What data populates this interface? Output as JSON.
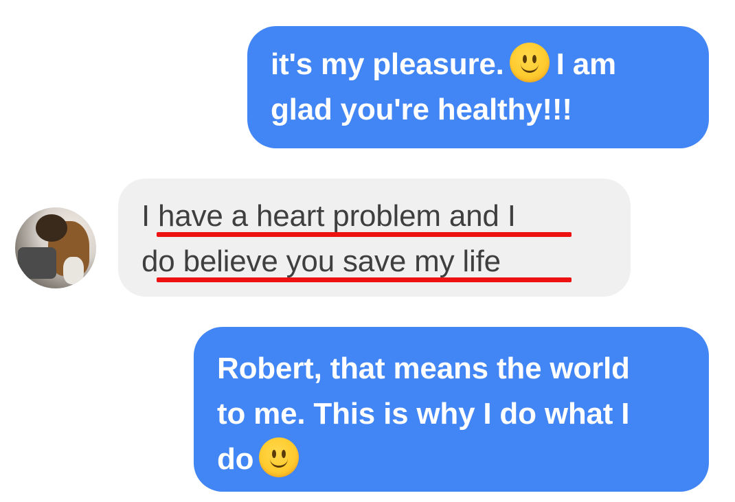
{
  "messages": [
    {
      "direction": "sent",
      "line1": "it's my pleasure.",
      "line1_after_emoji": "I am",
      "line2": "glad you're healthy!!!",
      "emoji": "slightly-smiling-face-icon"
    },
    {
      "direction": "received",
      "line1": "I have a heart problem and I",
      "line2": "do believe you save my life",
      "highlight": "red-underline"
    },
    {
      "direction": "sent",
      "line1": "Robert, that means the world",
      "line2": "to me. This is why I do what I",
      "line3": "do",
      "emoji": "slightly-smiling-face-icon"
    }
  ],
  "colors": {
    "sent_bubble": "#4285f4",
    "received_bubble": "#f1f0f0",
    "underline": "#ee1111"
  },
  "avatar": {
    "icon": "contact-avatar"
  }
}
